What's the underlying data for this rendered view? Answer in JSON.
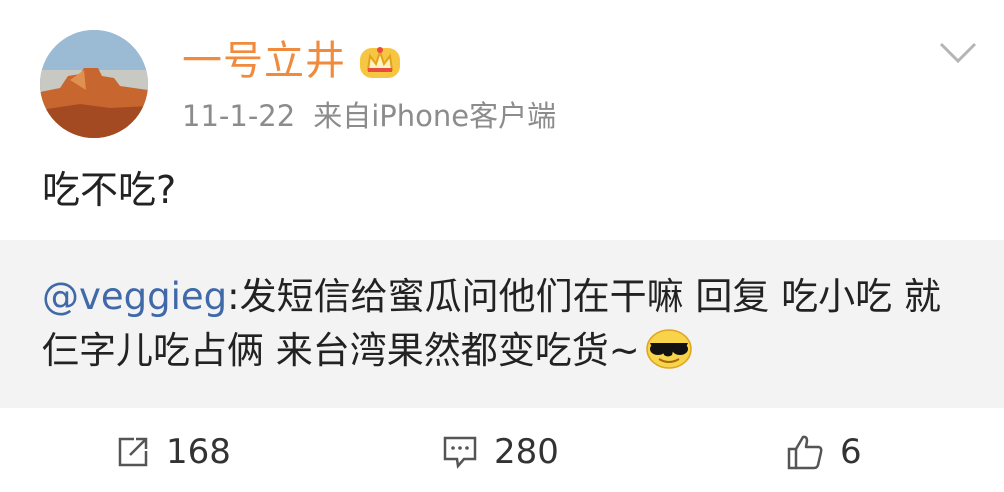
{
  "post": {
    "username": "一号立井",
    "date": "11-1-22",
    "source": "来自iPhone客户端",
    "text": "吃不吃?"
  },
  "repost": {
    "mention": "@veggieg",
    "text": ":发短信给蜜瓜问他们在干嘛 回复 吃小吃 就仨字儿吃占俩 来台湾果然都变吃货~"
  },
  "actions": {
    "repost_count": "168",
    "comment_count": "280",
    "like_count": "6"
  },
  "icons": [
    "avatar",
    "crown-badge-icon",
    "chevron-down-icon",
    "sunglasses-emoji-icon",
    "repost-icon",
    "comment-icon",
    "like-icon"
  ],
  "colors": {
    "username": "#f08a3c",
    "mention": "#3f69a8",
    "meta": "#8c8c8c",
    "repost_bg": "#f3f3f3"
  }
}
